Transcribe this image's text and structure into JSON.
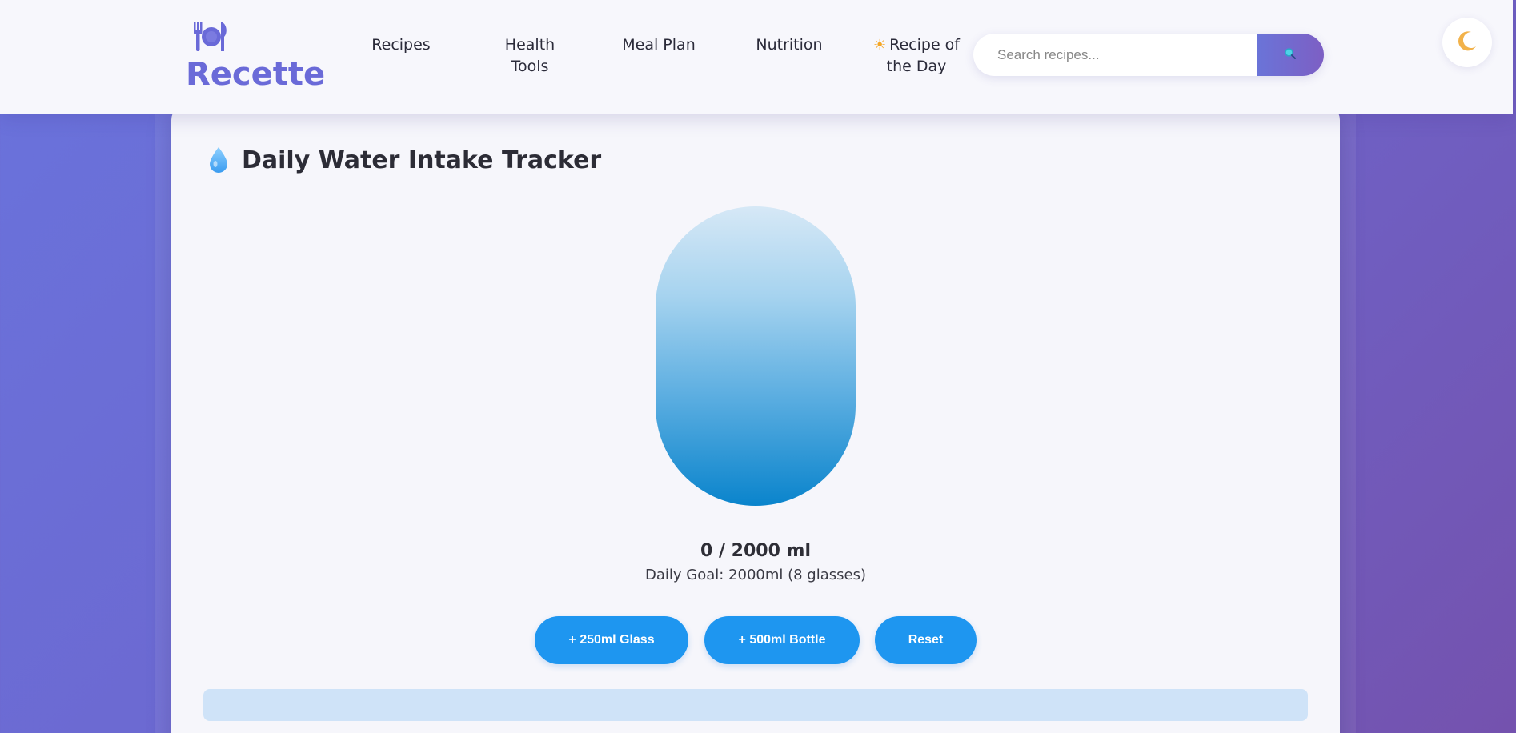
{
  "brand": {
    "name": "Recette",
    "icon": "plate-utensils-icon",
    "color": "#6a6ad8"
  },
  "nav": {
    "recipes": "Recipes",
    "health_tools": "Health Tools",
    "meal_plan": "Meal Plan",
    "nutrition": "Nutrition",
    "recipe_of_the_day": "Recipe of the Day",
    "recipe_of_the_day_icon": "sun-icon"
  },
  "search": {
    "placeholder": "Search recipes...",
    "value": "",
    "button_icon": "search-icon"
  },
  "theme_toggle": {
    "icon": "moon-icon"
  },
  "tracker": {
    "title": "Daily Water Intake Tracker",
    "title_icon": "water-drop-icon",
    "consumed_ml": 0,
    "goal_ml": 2000,
    "fill_fraction": 0,
    "progress_text": "0 / 2000 ml",
    "goal_text": "Daily Goal: 2000ml (8 glasses)",
    "buttons": {
      "glass": "+ 250ml Glass",
      "bottle": "+ 500ml Bottle",
      "reset": "Reset"
    }
  },
  "colors": {
    "accent": "#1e96f0",
    "brand_purple": "#6a6ad8",
    "background_gradient_start": "#6a73dc",
    "background_gradient_end": "#7452ae"
  }
}
